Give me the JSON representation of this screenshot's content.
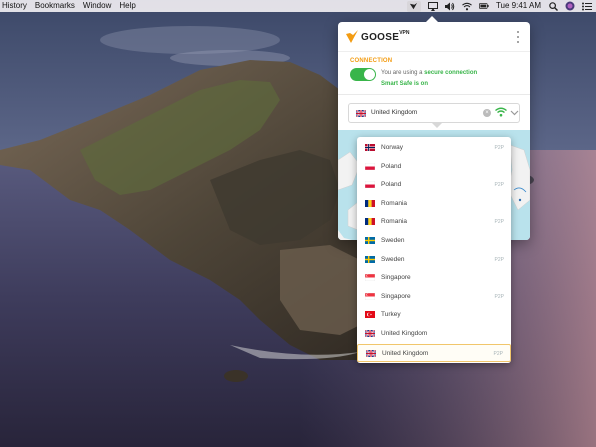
{
  "menubar": {
    "items": [
      "History",
      "Bookmarks",
      "Window",
      "Help"
    ],
    "clock": "Tue 9:41 AM"
  },
  "popover": {
    "brand": "GOOSE",
    "brand_sup": "VPN",
    "connection_label": "CONNECTION",
    "status_prefix": "You are using a",
    "status_highlight": "secure connection",
    "smart_safe": "Smart Safe is on",
    "selected_country": "United Kingdom",
    "accent": "#f39c12",
    "green": "#39b54a"
  },
  "dropdown": {
    "items": [
      {
        "name": "Norway",
        "tag": "P2P",
        "flag": "norway-flag-icon"
      },
      {
        "name": "Poland",
        "tag": "",
        "flag": "poland-flag-icon"
      },
      {
        "name": "Poland",
        "tag": "P2P",
        "flag": "poland-flag-icon"
      },
      {
        "name": "Romania",
        "tag": "",
        "flag": "romania-flag-icon"
      },
      {
        "name": "Romania",
        "tag": "P2P",
        "flag": "romania-flag-icon"
      },
      {
        "name": "Sweden",
        "tag": "",
        "flag": "sweden-flag-icon"
      },
      {
        "name": "Sweden",
        "tag": "P2P",
        "flag": "sweden-flag-icon"
      },
      {
        "name": "Singapore",
        "tag": "",
        "flag": "singapore-flag-icon"
      },
      {
        "name": "Singapore",
        "tag": "P2P",
        "flag": "singapore-flag-icon"
      },
      {
        "name": "Turkey",
        "tag": "",
        "flag": "turkey-flag-icon"
      },
      {
        "name": "United Kingdom",
        "tag": "",
        "flag": "uk-flag-icon"
      },
      {
        "name": "United Kingdom",
        "tag": "P2P",
        "flag": "uk-flag-icon",
        "selected": true
      }
    ]
  }
}
